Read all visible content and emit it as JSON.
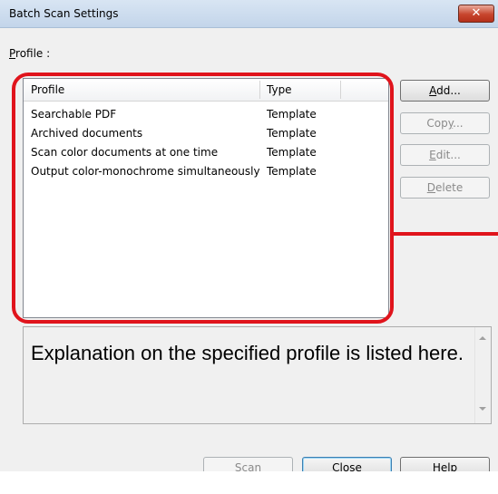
{
  "window": {
    "title": "Batch Scan Settings",
    "close_glyph": "✕"
  },
  "profile_label": {
    "text": "Profile :",
    "mnemonic": "P",
    "rest": "rofile :"
  },
  "list": {
    "columns": [
      {
        "label": "Profile"
      },
      {
        "label": "Type"
      }
    ],
    "rows": [
      {
        "profile": "Searchable PDF",
        "type": "Template"
      },
      {
        "profile": "Archived documents",
        "type": "Template"
      },
      {
        "profile": "Scan color documents at one time",
        "type": "Template"
      },
      {
        "profile": "Output color-monochrome simultaneously",
        "type": "Template"
      }
    ]
  },
  "side_buttons": {
    "add": {
      "label": "Add...",
      "mnemonic": "A",
      "rest": "dd..."
    },
    "copy": {
      "label": "Copy...",
      "pre": "Cop",
      "mnemonic": "y",
      "rest": "..."
    },
    "edit": {
      "label": "Edit...",
      "mnemonic": "E",
      "rest": "dit..."
    },
    "delete": {
      "label": "Delete",
      "mnemonic": "D",
      "rest": "elete"
    }
  },
  "description": {
    "text": "Explanation on the specified profile is listed here."
  },
  "bottom_buttons": {
    "scan": {
      "label": "Scan",
      "mnemonic": "S",
      "rest": "can"
    },
    "close": {
      "label": "Close"
    },
    "help": {
      "label": "Help"
    }
  },
  "colors": {
    "highlight": "#e0141c",
    "titlebar": "#c3d5ea",
    "close_button": "#c7452d"
  }
}
